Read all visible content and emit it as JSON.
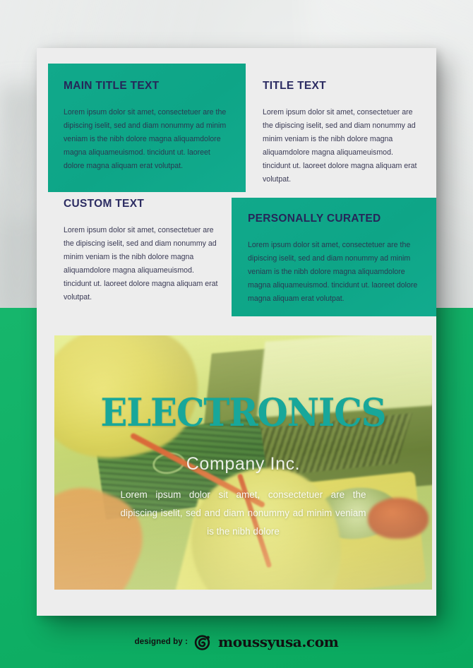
{
  "theme": {
    "teal": "#11a98b",
    "green": "#0ab264",
    "navy": "#2c2c62",
    "card_bg": "#ededed",
    "backdrop": "#d9dcdb",
    "photo_title_color": "#18a79a"
  },
  "blocks": [
    {
      "id": "main",
      "heading": "MAIN TITLE TEXT",
      "body": "Lorem ipsum dolor sit amet, consectetuer are the dipiscing iselit, sed and diam nonummy ad minim veniam is the nibh dolore magna aliquamdolore magna aliquameuismod. tincidunt ut. laoreet dolore magna aliquam erat volutpat.",
      "style": "teal"
    },
    {
      "id": "title",
      "heading": "TITLE TEXT",
      "body": "Lorem ipsum dolor sit amet, consectetuer are the dipiscing iselit, sed and diam nonummy ad minim veniam is the nibh dolore magna aliquamdolore magna aliquameuismod. tincidunt ut. laoreet dolore magna aliquam erat volutpat.",
      "style": "plain"
    },
    {
      "id": "custom",
      "heading": "CUSTOM TEXT",
      "body": "Lorem ipsum dolor sit amet, consectetuer are the dipiscing iselit, sed and diam nonummy ad minim veniam is the nibh dolore magna aliquamdolore magna aliquameuismod. tincidunt ut. laoreet dolore magna aliquam erat volutpat.",
      "style": "plain"
    },
    {
      "id": "curated",
      "heading": "PERSONALLY CURATED",
      "body": "Lorem ipsum dolor sit amet, consectetuer are the dipiscing iselit, sed and diam nonummy ad minim veniam is the nibh dolore magna aliquamdolore magna aliquameuismod. tincidunt ut. laoreet dolore magna aliquam erat volutpat.",
      "style": "teal"
    }
  ],
  "photo": {
    "title": "ELECTRONICS",
    "subtitle": "Company Inc.",
    "body": "Lorem ipsum dolor sit amet, consectetuer are the dipiscing iselit, sed and diam nonummy ad minim veniam is the nibh dolore",
    "alt": "electronics-workbench-photo"
  },
  "footer": {
    "designed_by": "designed by :",
    "brand": "moussyusa.com",
    "logo_icon": "moussy-circle-swirl-icon"
  }
}
